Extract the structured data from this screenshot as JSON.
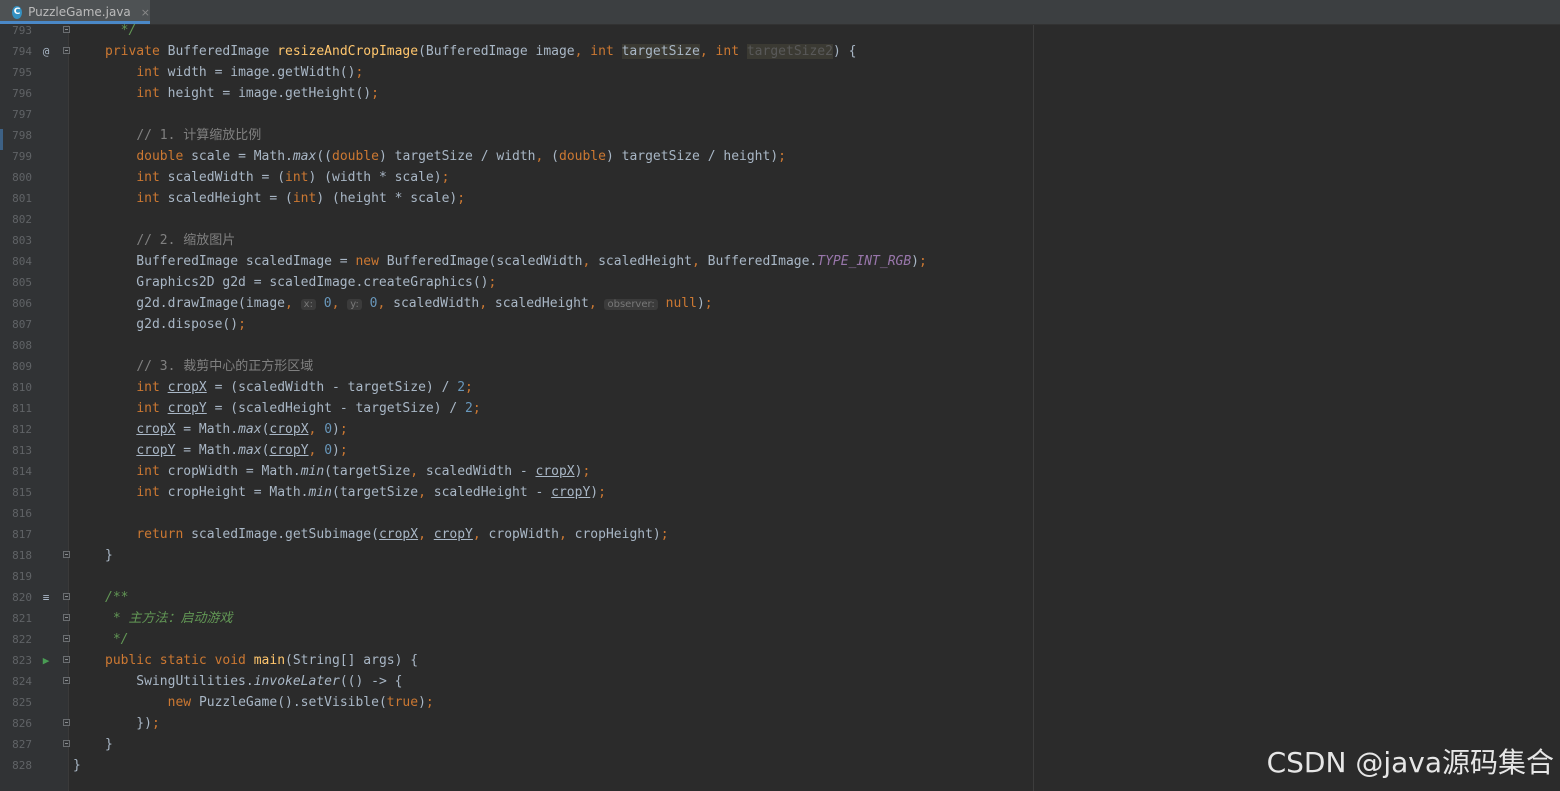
{
  "tab": {
    "filename": "PuzzleGame.java",
    "close": "×",
    "file_icon": "C"
  },
  "watermark": "CSDN @java源码集合",
  "lines": [
    {
      "no": "793",
      "segs": [
        {
          "t": "*/",
          "c": "dc"
        }
      ],
      "indent": "  ",
      "fold": true
    },
    {
      "no": "794",
      "marker": "@",
      "segs": [
        {
          "t": "private ",
          "c": "k"
        },
        {
          "t": "BufferedImage "
        },
        {
          "t": "resizeAndCropImage",
          "c": "m"
        },
        {
          "t": "(BufferedImage image"
        },
        {
          "t": ", ",
          "c": "k"
        },
        {
          "t": "int ",
          "c": "k"
        },
        {
          "t": "targetSize",
          "c": "hl"
        },
        {
          "t": ", ",
          "c": "k"
        },
        {
          "t": "int ",
          "c": "k"
        },
        {
          "t": "targetSize2",
          "c": "dim"
        },
        {
          "t": ") {"
        }
      ],
      "fold": true
    },
    {
      "no": "795",
      "segs": [
        {
          "t": "    "
        },
        {
          "t": "int ",
          "c": "k"
        },
        {
          "t": "width = image.getWidth()"
        },
        {
          "t": ";",
          "c": "k"
        }
      ]
    },
    {
      "no": "796",
      "segs": [
        {
          "t": "    "
        },
        {
          "t": "int ",
          "c": "k"
        },
        {
          "t": "height = image.getHeight()"
        },
        {
          "t": ";",
          "c": "k"
        }
      ]
    },
    {
      "no": "797",
      "segs": []
    },
    {
      "no": "798",
      "segs": [
        {
          "t": "    "
        },
        {
          "t": "// 1. 计算缩放比例",
          "c": "c"
        }
      ]
    },
    {
      "no": "799",
      "segs": [
        {
          "t": "    "
        },
        {
          "t": "double ",
          "c": "k"
        },
        {
          "t": "scale = Math."
        },
        {
          "t": "max",
          "c": "it"
        },
        {
          "t": "(("
        },
        {
          "t": "double",
          "c": "k"
        },
        {
          "t": ") targetSize / width"
        },
        {
          "t": ", ",
          "c": "k"
        },
        {
          "t": "("
        },
        {
          "t": "double",
          "c": "k"
        },
        {
          "t": ") targetSize / height)"
        },
        {
          "t": ";",
          "c": "k"
        }
      ]
    },
    {
      "no": "800",
      "segs": [
        {
          "t": "    "
        },
        {
          "t": "int ",
          "c": "k"
        },
        {
          "t": "scaledWidth = ("
        },
        {
          "t": "int",
          "c": "k"
        },
        {
          "t": ") (width * scale)"
        },
        {
          "t": ";",
          "c": "k"
        }
      ]
    },
    {
      "no": "801",
      "segs": [
        {
          "t": "    "
        },
        {
          "t": "int ",
          "c": "k"
        },
        {
          "t": "scaledHeight = ("
        },
        {
          "t": "int",
          "c": "k"
        },
        {
          "t": ") (height * scale)"
        },
        {
          "t": ";",
          "c": "k"
        }
      ]
    },
    {
      "no": "802",
      "segs": []
    },
    {
      "no": "803",
      "segs": [
        {
          "t": "    "
        },
        {
          "t": "// 2. 缩放图片",
          "c": "c"
        }
      ]
    },
    {
      "no": "804",
      "segs": [
        {
          "t": "    BufferedImage scaledImage = "
        },
        {
          "t": "new ",
          "c": "k"
        },
        {
          "t": "BufferedImage(scaledWidth"
        },
        {
          "t": ", ",
          "c": "k"
        },
        {
          "t": "scaledHeight"
        },
        {
          "t": ", ",
          "c": "k"
        },
        {
          "t": "BufferedImage."
        },
        {
          "t": "TYPE_INT_RGB",
          "c": "cn"
        },
        {
          "t": ")"
        },
        {
          "t": ";",
          "c": "k"
        }
      ]
    },
    {
      "no": "805",
      "segs": [
        {
          "t": "    Graphics2D g2d = scaledImage.createGraphics()"
        },
        {
          "t": ";",
          "c": "k"
        }
      ]
    },
    {
      "no": "806",
      "segs": [
        {
          "t": "    g2d.drawImage(image"
        },
        {
          "t": ", ",
          "c": "k"
        },
        {
          "t": "x:",
          "c": "hint"
        },
        {
          "t": " "
        },
        {
          "t": "0",
          "c": "n"
        },
        {
          "t": ", ",
          "c": "k"
        },
        {
          "t": "y:",
          "c": "hint"
        },
        {
          "t": " "
        },
        {
          "t": "0",
          "c": "n"
        },
        {
          "t": ", ",
          "c": "k"
        },
        {
          "t": "scaledWidth"
        },
        {
          "t": ", ",
          "c": "k"
        },
        {
          "t": "scaledHeight"
        },
        {
          "t": ", ",
          "c": "k"
        },
        {
          "t": "observer:",
          "c": "hint"
        },
        {
          "t": " "
        },
        {
          "t": "null",
          "c": "k"
        },
        {
          "t": ")"
        },
        {
          "t": ";",
          "c": "k"
        }
      ]
    },
    {
      "no": "807",
      "segs": [
        {
          "t": "    g2d.dispose()"
        },
        {
          "t": ";",
          "c": "k"
        }
      ]
    },
    {
      "no": "808",
      "segs": []
    },
    {
      "no": "809",
      "segs": [
        {
          "t": "    "
        },
        {
          "t": "// 3. 裁剪中心的正方形区域",
          "c": "c"
        }
      ]
    },
    {
      "no": "810",
      "segs": [
        {
          "t": "    "
        },
        {
          "t": "int ",
          "c": "k"
        },
        {
          "t": "cropX",
          "c": "u"
        },
        {
          "t": " = (scaledWidth - targetSize) / "
        },
        {
          "t": "2",
          "c": "n"
        },
        {
          "t": ";",
          "c": "k"
        }
      ]
    },
    {
      "no": "811",
      "segs": [
        {
          "t": "    "
        },
        {
          "t": "int ",
          "c": "k"
        },
        {
          "t": "cropY",
          "c": "u"
        },
        {
          "t": " = (scaledHeight - targetSize) / "
        },
        {
          "t": "2",
          "c": "n"
        },
        {
          "t": ";",
          "c": "k"
        }
      ]
    },
    {
      "no": "812",
      "segs": [
        {
          "t": "    "
        },
        {
          "t": "cropX",
          "c": "u"
        },
        {
          "t": " = Math."
        },
        {
          "t": "max",
          "c": "it"
        },
        {
          "t": "("
        },
        {
          "t": "cropX",
          "c": "u"
        },
        {
          "t": ", ",
          "c": "k"
        },
        {
          "t": "0",
          "c": "n"
        },
        {
          "t": ")"
        },
        {
          "t": ";",
          "c": "k"
        }
      ]
    },
    {
      "no": "813",
      "segs": [
        {
          "t": "    "
        },
        {
          "t": "cropY",
          "c": "u"
        },
        {
          "t": " = Math."
        },
        {
          "t": "max",
          "c": "it"
        },
        {
          "t": "("
        },
        {
          "t": "cropY",
          "c": "u"
        },
        {
          "t": ", ",
          "c": "k"
        },
        {
          "t": "0",
          "c": "n"
        },
        {
          "t": ")"
        },
        {
          "t": ";",
          "c": "k"
        }
      ]
    },
    {
      "no": "814",
      "segs": [
        {
          "t": "    "
        },
        {
          "t": "int ",
          "c": "k"
        },
        {
          "t": "cropWidth = Math."
        },
        {
          "t": "min",
          "c": "it"
        },
        {
          "t": "(targetSize"
        },
        {
          "t": ", ",
          "c": "k"
        },
        {
          "t": "scaledWidth - "
        },
        {
          "t": "cropX",
          "c": "u"
        },
        {
          "t": ")"
        },
        {
          "t": ";",
          "c": "k"
        }
      ]
    },
    {
      "no": "815",
      "segs": [
        {
          "t": "    "
        },
        {
          "t": "int ",
          "c": "k"
        },
        {
          "t": "cropHeight = Math."
        },
        {
          "t": "min",
          "c": "it"
        },
        {
          "t": "(targetSize"
        },
        {
          "t": ", ",
          "c": "k"
        },
        {
          "t": "scaledHeight - "
        },
        {
          "t": "cropY",
          "c": "u"
        },
        {
          "t": ")"
        },
        {
          "t": ";",
          "c": "k"
        }
      ]
    },
    {
      "no": "816",
      "segs": []
    },
    {
      "no": "817",
      "segs": [
        {
          "t": "    "
        },
        {
          "t": "return ",
          "c": "k"
        },
        {
          "t": "scaledImage.getSubimage("
        },
        {
          "t": "cropX",
          "c": "u"
        },
        {
          "t": ", ",
          "c": "k"
        },
        {
          "t": "cropY",
          "c": "u"
        },
        {
          "t": ", ",
          "c": "k"
        },
        {
          "t": "cropWidth"
        },
        {
          "t": ", ",
          "c": "k"
        },
        {
          "t": "cropHeight)"
        },
        {
          "t": ";",
          "c": "k"
        }
      ]
    },
    {
      "no": "818",
      "segs": [
        {
          "t": "}"
        }
      ],
      "fold": true
    },
    {
      "no": "819",
      "segs": []
    },
    {
      "no": "820",
      "marker": "≡",
      "segs": [
        {
          "t": "/**",
          "c": "dc"
        }
      ],
      "fold": true
    },
    {
      "no": "821",
      "segs": [
        {
          "t": " * 主方法：启动游戏",
          "c": "dc"
        }
      ],
      "fold": true
    },
    {
      "no": "822",
      "segs": [
        {
          "t": " */",
          "c": "dc"
        }
      ],
      "fold": true
    },
    {
      "no": "823",
      "marker": "▶",
      "segs": [
        {
          "t": "public static void ",
          "c": "k"
        },
        {
          "t": "main",
          "c": "m"
        },
        {
          "t": "(String[] args) {"
        }
      ],
      "fold": true
    },
    {
      "no": "824",
      "segs": [
        {
          "t": "    SwingUtilities."
        },
        {
          "t": "invokeLater",
          "c": "it"
        },
        {
          "t": "(() -> {"
        }
      ],
      "fold": true
    },
    {
      "no": "825",
      "segs": [
        {
          "t": "        "
        },
        {
          "t": "new ",
          "c": "k"
        },
        {
          "t": "PuzzleGame().setVisible("
        },
        {
          "t": "true",
          "c": "k"
        },
        {
          "t": ")"
        },
        {
          "t": ";",
          "c": "k"
        }
      ]
    },
    {
      "no": "826",
      "segs": [
        {
          "t": "    })"
        },
        {
          "t": ";",
          "c": "k"
        }
      ],
      "fold": true
    },
    {
      "no": "827",
      "segs": [
        {
          "t": "}"
        }
      ],
      "fold": true
    },
    {
      "no": "828",
      "segs": [
        {
          "t": "}"
        }
      ],
      "outdent": true
    }
  ]
}
